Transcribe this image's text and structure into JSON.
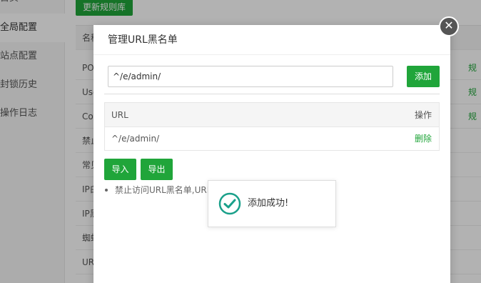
{
  "sidebar": {
    "items": [
      {
        "label": "首页"
      },
      {
        "label": "全局配置"
      },
      {
        "label": "站点配置"
      },
      {
        "label": "封锁历史"
      },
      {
        "label": "操作日志"
      }
    ]
  },
  "content": {
    "update_rules_button": "更新规则库",
    "table_header": "名称",
    "rows": [
      {
        "name": "PO",
        "action": "规"
      },
      {
        "name": "Use",
        "action": "规"
      },
      {
        "name": "Co",
        "action": "规"
      },
      {
        "name": "禁止"
      },
      {
        "name": "常见"
      },
      {
        "name": "IP白"
      },
      {
        "name": "IP黑"
      },
      {
        "name": "蜘蛛"
      },
      {
        "name": "URL"
      }
    ]
  },
  "modal": {
    "title": "管理URL黑名单",
    "input_value": "^/e/admin/",
    "add_button": "添加",
    "table": {
      "col_url": "URL",
      "col_action": "操作",
      "rows": [
        {
          "url": "^/e/admin/",
          "action": "删除"
        }
      ]
    },
    "import_button": "导入",
    "export_button": "导出",
    "tip": "禁止访问URL黑名单,URL"
  },
  "toast": {
    "message": "添加成功!",
    "icon": "check-circle-icon"
  },
  "colors": {
    "accent": "#20a53a"
  }
}
